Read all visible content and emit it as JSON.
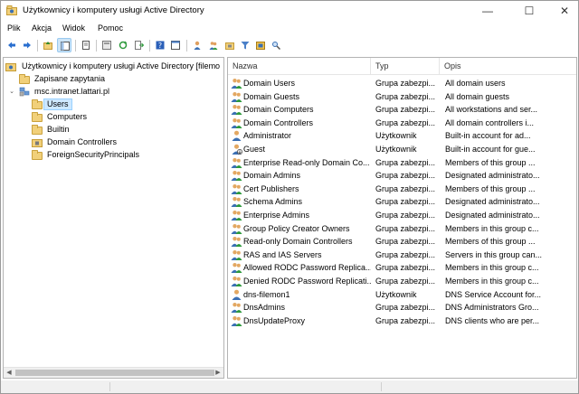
{
  "window": {
    "title": "Użytkownicy i komputery usługi Active Directory",
    "minimize_symbol": "—",
    "maximize_symbol": "☐",
    "close_symbol": "✕"
  },
  "menu": [
    "Plik",
    "Akcja",
    "Widok",
    "Pomoc"
  ],
  "toolbar": {
    "icons": [
      "back-icon",
      "forward-icon",
      "up-folder-icon",
      "show-console-tree-icon",
      "copy-icon",
      "properties-icon",
      "export-list-icon",
      "refresh-icon",
      "help-icon",
      "console-icon",
      "new-user-icon",
      "new-group-icon",
      "new-ou-icon",
      "filter-icon",
      "add-to-group-icon",
      "find-icon"
    ]
  },
  "tree": {
    "root": "Użytkownicy i komputery usługi Active Directory [filemo",
    "saved_queries": "Zapisane zapytania",
    "domain": "msc.intranet.lattari.pl",
    "children": [
      "Users",
      "Computers",
      "Builtin",
      "Domain Controllers",
      "ForeignSecurityPrincipals"
    ],
    "selected": "Users"
  },
  "list": {
    "columns": [
      "Nazwa",
      "Typ",
      "Opis"
    ],
    "rows": [
      {
        "name": "Domain Users",
        "type": "Grupa zabezpi...",
        "desc": "All domain users",
        "kind": "group"
      },
      {
        "name": "Domain Guests",
        "type": "Grupa zabezpi...",
        "desc": "All domain guests",
        "kind": "group"
      },
      {
        "name": "Domain Computers",
        "type": "Grupa zabezpi...",
        "desc": "All workstations and ser...",
        "kind": "group"
      },
      {
        "name": "Domain Controllers",
        "type": "Grupa zabezpi...",
        "desc": "All domain controllers i...",
        "kind": "group"
      },
      {
        "name": "Administrator",
        "type": "Użytkownik",
        "desc": "Built-in account for ad...",
        "kind": "user"
      },
      {
        "name": "Guest",
        "type": "Użytkownik",
        "desc": "Built-in account for gue...",
        "kind": "user-disabled"
      },
      {
        "name": "Enterprise Read-only Domain Co...",
        "type": "Grupa zabezpi...",
        "desc": "Members of this group ...",
        "kind": "group"
      },
      {
        "name": "Domain Admins",
        "type": "Grupa zabezpi...",
        "desc": "Designated administrato...",
        "kind": "group"
      },
      {
        "name": "Cert Publishers",
        "type": "Grupa zabezpi...",
        "desc": "Members of this group ...",
        "kind": "group"
      },
      {
        "name": "Schema Admins",
        "type": "Grupa zabezpi...",
        "desc": "Designated administrato...",
        "kind": "group"
      },
      {
        "name": "Enterprise Admins",
        "type": "Grupa zabezpi...",
        "desc": "Designated administrato...",
        "kind": "group"
      },
      {
        "name": "Group Policy Creator Owners",
        "type": "Grupa zabezpi...",
        "desc": "Members in this group c...",
        "kind": "group"
      },
      {
        "name": "Read-only Domain Controllers",
        "type": "Grupa zabezpi...",
        "desc": "Members of this group ...",
        "kind": "group"
      },
      {
        "name": "RAS and IAS Servers",
        "type": "Grupa zabezpi...",
        "desc": "Servers in this group can...",
        "kind": "group"
      },
      {
        "name": "Allowed RODC Password Replica...",
        "type": "Grupa zabezpi...",
        "desc": "Members in this group c...",
        "kind": "group"
      },
      {
        "name": "Denied RODC Password Replicati...",
        "type": "Grupa zabezpi...",
        "desc": "Members in this group c...",
        "kind": "group"
      },
      {
        "name": "dns-filemon1",
        "type": "Użytkownik",
        "desc": "DNS Service Account for...",
        "kind": "user"
      },
      {
        "name": "DnsAdmins",
        "type": "Grupa zabezpi...",
        "desc": "DNS Administrators Gro...",
        "kind": "group"
      },
      {
        "name": "DnsUpdateProxy",
        "type": "Grupa zabezpi...",
        "desc": "DNS clients who are per...",
        "kind": "group"
      }
    ]
  },
  "colors": {
    "selection_bg": "#cde8ff",
    "selection_border": "#99d1ff",
    "folder": "#f1d07a"
  }
}
